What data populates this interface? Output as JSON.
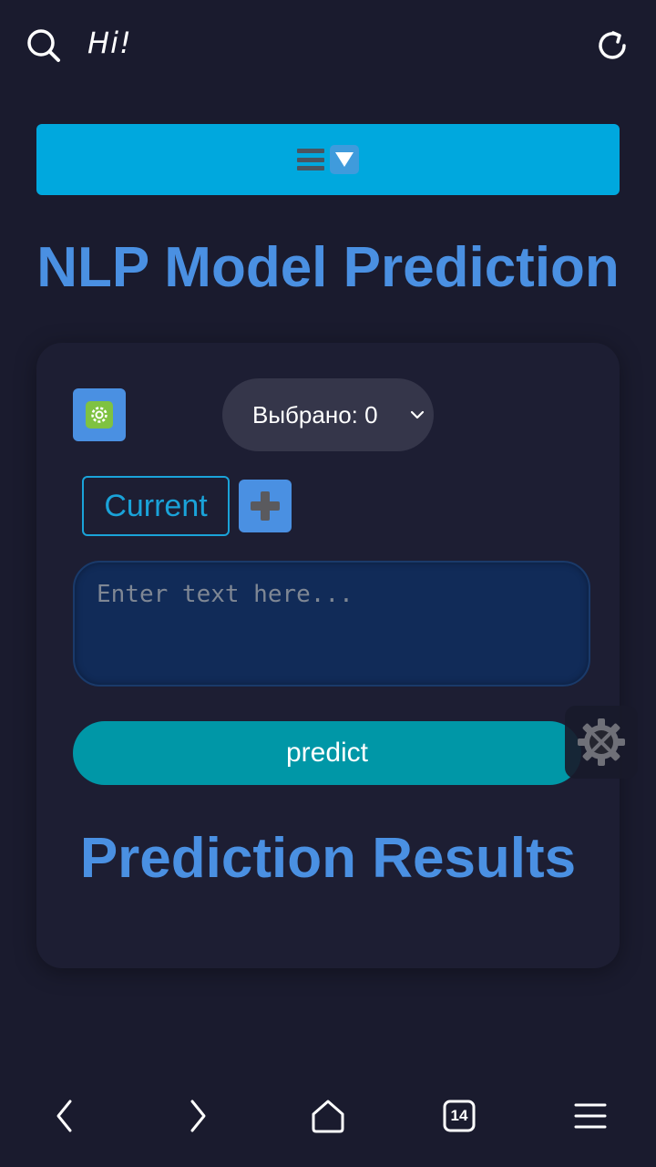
{
  "browser": {
    "greeting": "Hi!",
    "tabs_count": "14",
    "icons": {
      "search": "search-icon",
      "refresh": "refresh-icon",
      "back": "chevron-left-icon",
      "forward": "chevron-right-icon",
      "home": "home-icon",
      "tabs": "tabs-icon",
      "menu": "hamburger-icon"
    }
  },
  "app": {
    "menu_icons": [
      "hamburger-icon",
      "down-triangle-icon"
    ],
    "title": "NLP Model Prediction",
    "settings_icon": "gear-icon",
    "model_select": {
      "value": "Выбрано: 0"
    },
    "tab_current": "Current",
    "add_icon": "plus-icon",
    "text_input": {
      "placeholder": "Enter text here...",
      "value": ""
    },
    "predict_label": "predict",
    "results_title": "Prediction Results",
    "floating_tool_icon": "tools-gear-icon"
  },
  "colors": {
    "background": "#1a1b2e",
    "card": "#1d1e33",
    "accent_blue": "#4a90e2",
    "menu_bar": "#00a8de",
    "predict_button": "#0097a7",
    "input_bg": "#112b58",
    "tab_border": "#1aa3d9"
  }
}
